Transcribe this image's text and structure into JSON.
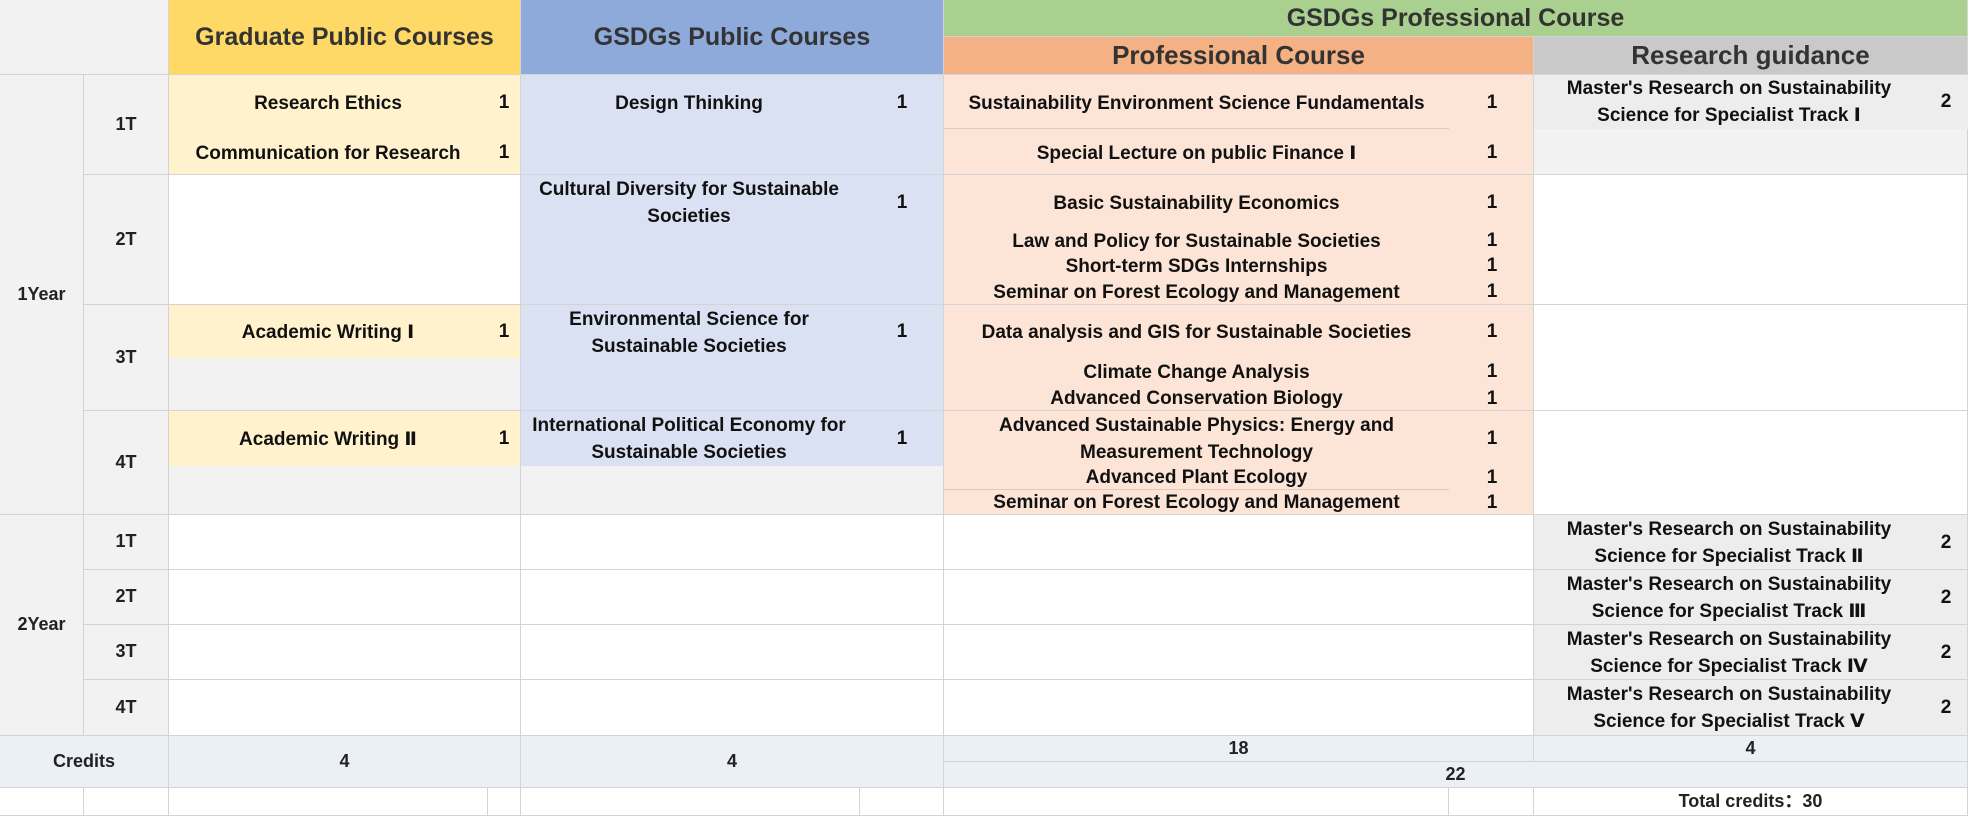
{
  "headers": {
    "graduate_public": "Graduate Public Courses",
    "gsdgs_public": "GSDGs Public Courses",
    "gsdgs_professional": "GSDGs Professional Course",
    "professional": "Professional Course",
    "research_guidance": "Research guidance"
  },
  "years": {
    "year1": "1Year",
    "year2": "2Year"
  },
  "terms": [
    "1T",
    "2T",
    "3T",
    "4T"
  ],
  "graduate_public_courses": {
    "research_ethics": {
      "name": "Research Ethics",
      "credit": "1"
    },
    "communication": {
      "name": "Communication for Research",
      "credit": "1"
    },
    "academic_writing_1": {
      "name": "Academic Writing Ⅰ",
      "credit": "1"
    },
    "academic_writing_2": {
      "name": "Academic Writing Ⅱ",
      "credit": "1"
    }
  },
  "gsdgs_public_courses": {
    "design_thinking": {
      "name": "Design Thinking",
      "credit": "1"
    },
    "cultural_diversity": {
      "name": "Cultural Diversity for Sustainable Societies",
      "credit": "1"
    },
    "environmental_science": {
      "name": "Environmental Science for Sustainable Societies",
      "credit": "1"
    },
    "political_economy": {
      "name": "International Political Economy for Sustainable Societies",
      "credit": "1"
    }
  },
  "professional_courses": {
    "fundamentals": {
      "name": "Sustainability Environment Science Fundamentals",
      "credit": "1"
    },
    "public_finance": {
      "name": "Special Lecture on public Finance Ⅰ",
      "credit": "1"
    },
    "economics": {
      "name": "Basic Sustainability Economics",
      "credit": "1"
    },
    "law_policy": {
      "name": "Law and Policy for Sustainable Societies",
      "credit": "1"
    },
    "internships": {
      "name": "Short-term SDGs Internships",
      "credit": "1"
    },
    "forest_seminar_1": {
      "name": "Seminar on Forest Ecology and Management",
      "credit": "1"
    },
    "data_gis": {
      "name": "Data analysis and GIS for Sustainable Societies",
      "credit": "1"
    },
    "climate": {
      "name": "Climate Change Analysis",
      "credit": "1"
    },
    "conservation": {
      "name": "Advanced Conservation Biology",
      "credit": "1"
    },
    "physics": {
      "name": "Advanced Sustainable Physics: Energy and Measurement Technology",
      "credit": "1"
    },
    "plant_ecology": {
      "name": "Advanced Plant Ecology",
      "credit": "1"
    },
    "forest_seminar_2": {
      "name": "Seminar on Forest Ecology and Management",
      "credit": "1"
    }
  },
  "research_guidance_courses": {
    "track1": {
      "name": "Master's Research on Sustainability Science for Specialist Track Ⅰ",
      "credit": "2"
    },
    "track2": {
      "name": "Master's Research on Sustainability Science for Specialist Track Ⅱ",
      "credit": "2"
    },
    "track3": {
      "name": "Master's Research on Sustainability Science for Specialist Track Ⅲ",
      "credit": "2"
    },
    "track4": {
      "name": "Master's Research on Sustainability Science for Specialist Track Ⅳ",
      "credit": "2"
    },
    "track5": {
      "name": "Master's Research on Sustainability Science for Specialist Track Ⅴ",
      "credit": "2"
    }
  },
  "credits": {
    "label": "Credits",
    "graduate_public": "4",
    "gsdgs_public": "4",
    "professional": "18",
    "research": "4",
    "gsdgs_total": "22",
    "total": "Total credits：30"
  }
}
